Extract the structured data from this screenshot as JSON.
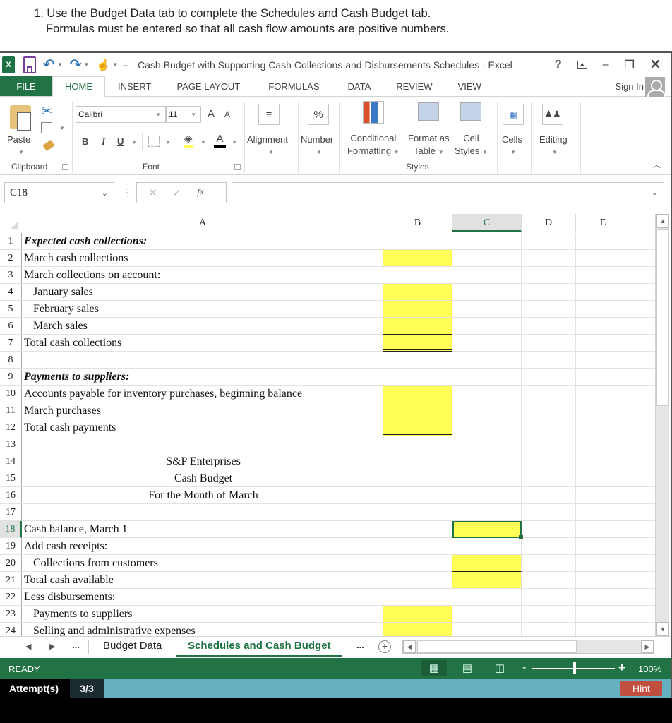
{
  "instructions": {
    "line1": "1. Use the Budget Data tab to complete the Schedules and Cash Budget tab.",
    "line2": "Formulas must be entered so that all cash flow amounts are positive numbers."
  },
  "window": {
    "title": "Cash Budget with Supporting Cash Collections and Disbursements Schedules - Excel",
    "app_icon": "excel-logo-icon",
    "help": "?",
    "minimize": "–",
    "restore": "🗗",
    "close": "✕"
  },
  "ribbon_tabs": [
    "FILE",
    "HOME",
    "INSERT",
    "PAGE LAYOUT",
    "FORMULAS",
    "DATA",
    "REVIEW",
    "VIEW"
  ],
  "active_tab": "HOME",
  "sign_in": "Sign In",
  "ribbon": {
    "clipboard": {
      "label": "Clipboard",
      "paste": "Paste"
    },
    "font": {
      "label": "Font",
      "name": "Calibri",
      "size": "11",
      "bold": "B",
      "italic": "I",
      "underline": "U",
      "grow": "A",
      "shrink": "A",
      "font_color": "A"
    },
    "alignment": "Alignment",
    "number": "Number",
    "number_icon": "%",
    "styles": {
      "label": "Styles",
      "conditional_line1": "Conditional",
      "conditional_line2": "Formatting",
      "format_table_line1": "Format as",
      "format_table_line2": "Table",
      "cell_styles_line1": "Cell",
      "cell_styles_line2": "Styles"
    },
    "cells": "Cells",
    "editing": "Editing"
  },
  "formula_bar": {
    "name_box": "C18",
    "cancel": "✕",
    "enter": "✓",
    "fx": "fx",
    "value": ""
  },
  "columns": [
    "A",
    "B",
    "C",
    "D",
    "E"
  ],
  "selected_column": "C",
  "selected_row": "18",
  "rows": [
    {
      "n": "1",
      "a": "Expected cash collections:",
      "style": "bold-italic"
    },
    {
      "n": "2",
      "a": "March cash collections",
      "b_input": true
    },
    {
      "n": "3",
      "a": "March collections on account:"
    },
    {
      "n": "4",
      "a": "January sales",
      "indent": true,
      "b_input": true
    },
    {
      "n": "5",
      "a": "February sales",
      "indent": true,
      "b_input": true
    },
    {
      "n": "6",
      "a": "March sales",
      "indent": true,
      "b_input": true,
      "b_underline": true
    },
    {
      "n": "7",
      "a": "Total cash collections",
      "b_input": true,
      "b_double": true
    },
    {
      "n": "8",
      "a": ""
    },
    {
      "n": "9",
      "a": "Payments to suppliers:",
      "style": "bold-italic"
    },
    {
      "n": "10",
      "a": "Accounts payable for inventory purchases, beginning balance",
      "b_input": true
    },
    {
      "n": "11",
      "a": "March purchases",
      "b_input": true,
      "b_underline": true
    },
    {
      "n": "12",
      "a": "Total cash payments",
      "b_input": true,
      "b_double": true
    },
    {
      "n": "13",
      "a": ""
    },
    {
      "n": "14",
      "center": "S&P Enterprises"
    },
    {
      "n": "15",
      "center": "Cash Budget"
    },
    {
      "n": "16",
      "center": "For the Month of March"
    },
    {
      "n": "17",
      "a": ""
    },
    {
      "n": "18",
      "a": "Cash balance, March 1",
      "c_input": true,
      "c_selected": true
    },
    {
      "n": "19",
      "a": "Add cash receipts:"
    },
    {
      "n": "20",
      "a": "Collections from customers",
      "indent": true,
      "c_input": true,
      "c_underline": true
    },
    {
      "n": "21",
      "a": "Total cash available",
      "c_input": true
    },
    {
      "n": "22",
      "a": "Less disbursements:"
    },
    {
      "n": "23",
      "a": "Payments to suppliers",
      "indent": true,
      "b_input": true
    },
    {
      "n": "24",
      "a": "Selling and administrative expenses",
      "indent": true,
      "b_input": true
    }
  ],
  "sheet_tabs": {
    "more_left": "...",
    "tab1": "Budget Data",
    "tab2": "Schedules and Cash Budget",
    "more_right": "...",
    "add": "+"
  },
  "active_sheet": "Schedules and Cash Budget",
  "status": {
    "mode": "READY",
    "zoom": "100%",
    "zoom_minus": "-",
    "zoom_plus": "+"
  },
  "zoom_level_percent": 100,
  "attempts": {
    "label": "Attempt(s)",
    "count": "3/3"
  },
  "hint_button": "Hint",
  "colors": {
    "excel_green": "#217346",
    "input_yellow": "#ffff55",
    "hint_red": "#c14f3f",
    "attempt_bar": "#64b0c0"
  }
}
